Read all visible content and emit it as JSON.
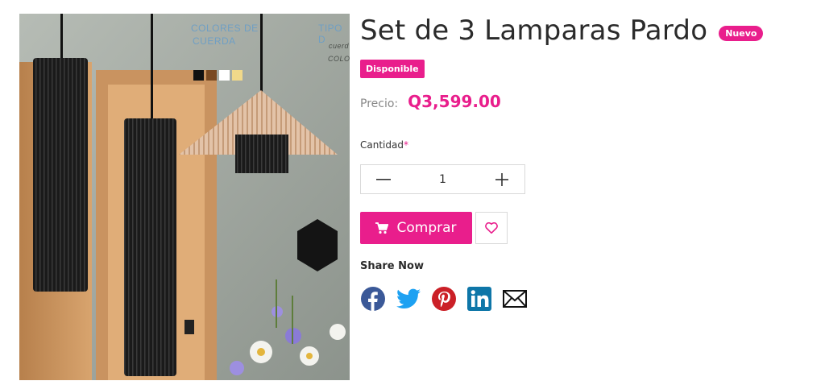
{
  "product": {
    "title": "Set de 3 Lamparas Pardo",
    "new_badge": "Nuevo",
    "availability": "Disponible",
    "price_label": "Precio:",
    "price": "Q3,599.00"
  },
  "image_overlay": {
    "line1": "COLORES DE",
    "line2": "CUERDA",
    "tipo": "TIPO D",
    "small1": "cuerd",
    "small2": "COLO",
    "swatches": [
      "#111111",
      "#7a4a22",
      "#ffffff",
      "#f1d98a"
    ]
  },
  "quantity": {
    "label": "Cantidad",
    "required_mark": "*",
    "value": "1",
    "minus": "—",
    "plus": "+"
  },
  "actions": {
    "buy_label": "Comprar"
  },
  "share": {
    "label": "Share Now",
    "networks": [
      "facebook-icon",
      "twitter-icon",
      "pinterest-icon",
      "linkedin-icon",
      "email-icon"
    ]
  },
  "colors": {
    "accent": "#e91e8c",
    "facebook": "#3b5998",
    "twitter": "#1da1f2",
    "pinterest": "#cb2027",
    "linkedin": "#0e76a8",
    "email": "#111111"
  }
}
